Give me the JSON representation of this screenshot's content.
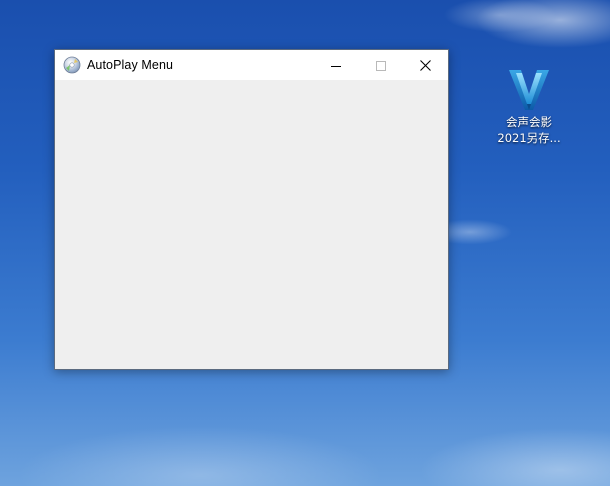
{
  "window": {
    "title": "AutoPlay Menu",
    "app_icon": "cd-disc-icon",
    "controls": {
      "minimize_icon": "minimize-icon",
      "maximize_icon": "maximize-icon",
      "close_icon": "close-icon"
    },
    "client_background": "#efefef"
  },
  "desktop": {
    "icons": [
      {
        "icon": "videostudio-v-logo-icon",
        "line1": "会声会影",
        "line2": "2021另存..."
      }
    ],
    "accent": "#2f6fd6"
  }
}
